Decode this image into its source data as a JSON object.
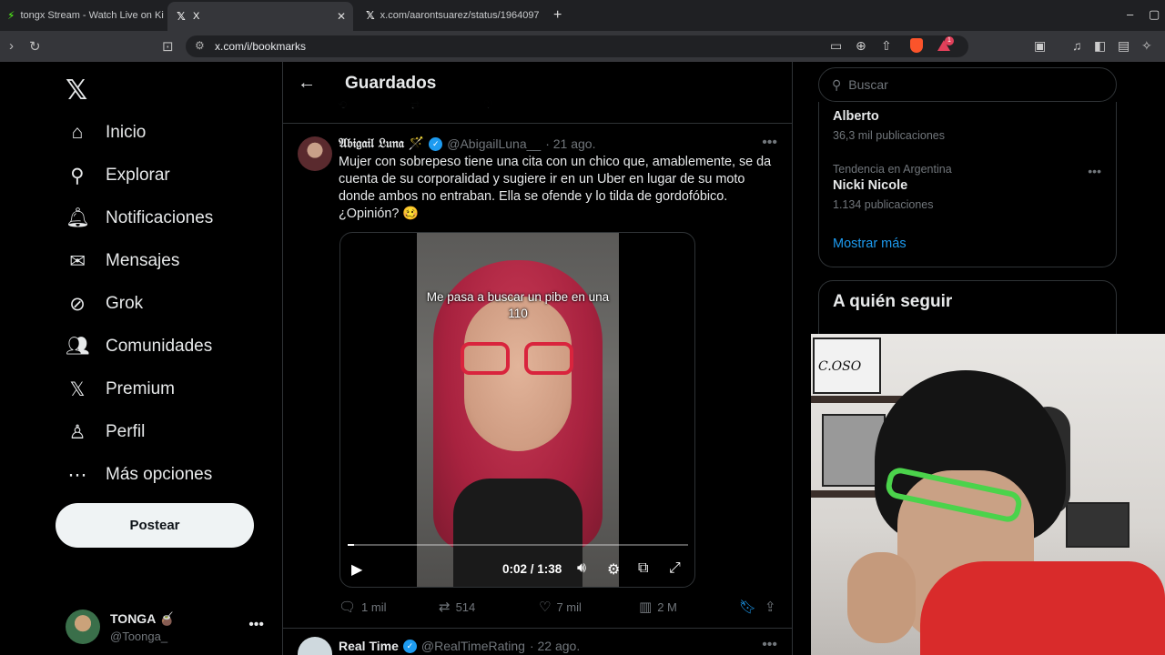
{
  "browser": {
    "tabs": [
      {
        "title": "tongx Stream - Watch Live on Kic",
        "icon": "kick-icon"
      },
      {
        "title": "X",
        "icon": "x-icon",
        "active": true
      },
      {
        "title": "x.com/aarontsuarez/status/1964097",
        "icon": "x-icon"
      }
    ],
    "url": "x.com/i/bookmarks"
  },
  "sidebar": {
    "items": [
      {
        "label": "Inicio",
        "icon": "home-icon",
        "glyph": "⌂"
      },
      {
        "label": "Explorar",
        "icon": "search-icon",
        "glyph": "⚲"
      },
      {
        "label": "Notificaciones",
        "icon": "bell-icon",
        "glyph": "🔔︎"
      },
      {
        "label": "Mensajes",
        "icon": "mail-icon",
        "glyph": "✉"
      },
      {
        "label": "Grok",
        "icon": "grok-icon",
        "glyph": "⊘"
      },
      {
        "label": "Comunidades",
        "icon": "communities-icon",
        "glyph": "👥︎"
      },
      {
        "label": "Premium",
        "icon": "x-premium-icon",
        "glyph": "𝕏"
      },
      {
        "label": "Perfil",
        "icon": "person-icon",
        "glyph": "♙"
      },
      {
        "label": "Más opciones",
        "icon": "more-circle-icon",
        "glyph": "⋯"
      }
    ],
    "post_button": "Postear",
    "account": {
      "name": "TONGA 🧉",
      "handle": "@Toonga_"
    }
  },
  "main": {
    "title": "Guardados",
    "tweet": {
      "name": "𝔄𝔟𝔦𝔤𝔞𝔦𝔩 𝔏𝔲𝔫𝔞 🪄",
      "handle": "@AbigailLuna__",
      "time": "· 21 ago.",
      "text": "Mujer con sobrepeso tiene una cita con un chico que, amablemente, se da cuenta de su corporalidad y sugiere ir en un Uber en lugar de su moto donde ambos no entraban. Ella se ofende y lo tilda de gordofóbico. ¿Opinión? 🥴",
      "video": {
        "caption": "Me pasa a buscar un pibe en una 110",
        "time": "0:02 / 1:38",
        "progress": 0.02
      },
      "actions": {
        "replies": "1 mil",
        "reposts": "514",
        "likes": "7 mil",
        "views": "2 M"
      }
    },
    "next_tweet": {
      "name": "Real Time",
      "handle": "@RealTimeRating",
      "time": "· 22 ago."
    }
  },
  "right": {
    "search_placeholder": "Buscar",
    "trends": [
      {
        "name": "Alberto",
        "posts": "36,3 mil publicaciones"
      },
      {
        "context": "Tendencia en Argentina",
        "name": "Nicki Nicole",
        "posts": "1.134 publicaciones"
      }
    ],
    "show_more": "Mostrar más",
    "who_to_follow": "A quién seguir"
  },
  "webcam": {
    "sign_text": "C.OSO"
  },
  "colors": {
    "accent": "#1d9bf0",
    "background": "#000000",
    "border": "#2f3336",
    "muted": "#71767b"
  }
}
